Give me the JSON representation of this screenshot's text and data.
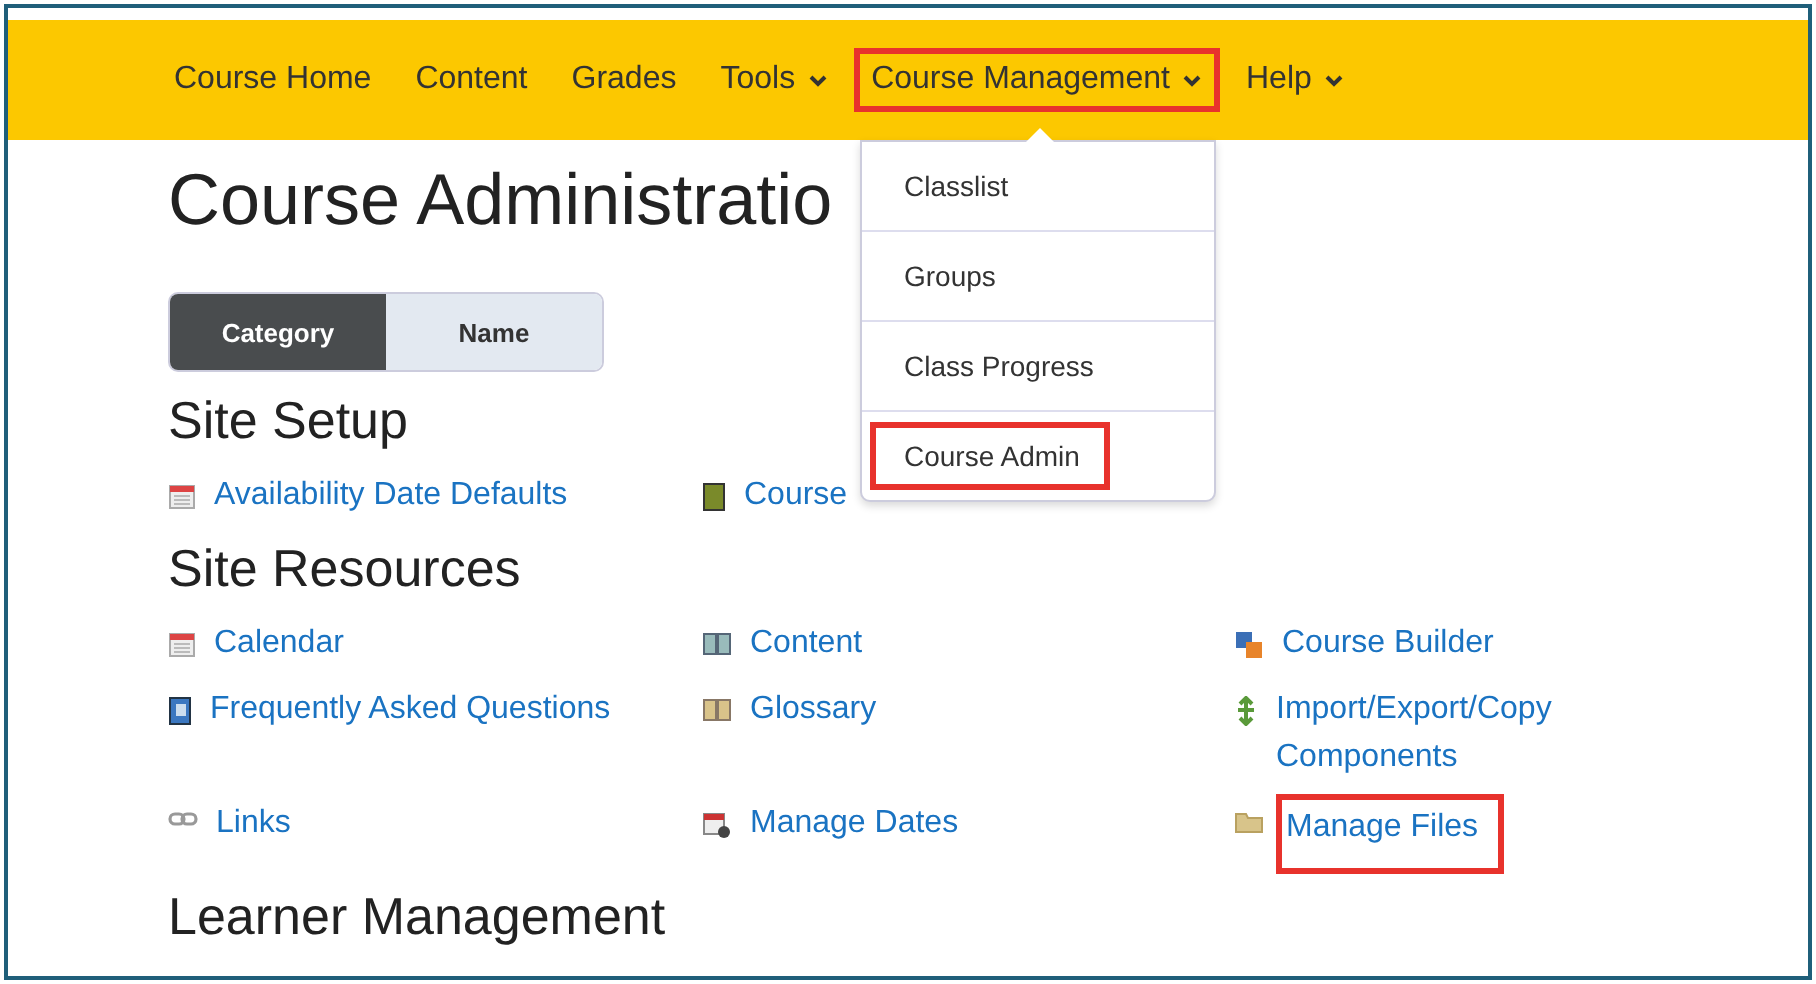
{
  "navbar": {
    "items": [
      {
        "label": "Course Home",
        "dropdown": false,
        "highlighted": false
      },
      {
        "label": "Content",
        "dropdown": false,
        "highlighted": false
      },
      {
        "label": "Grades",
        "dropdown": false,
        "highlighted": false
      },
      {
        "label": "Tools",
        "dropdown": true,
        "highlighted": false
      },
      {
        "label": "Course Management",
        "dropdown": true,
        "highlighted": true
      },
      {
        "label": "Help",
        "dropdown": true,
        "highlighted": false
      }
    ]
  },
  "menu": {
    "items": [
      {
        "label": "Classlist",
        "highlighted": false
      },
      {
        "label": "Groups",
        "highlighted": false
      },
      {
        "label": "Class Progress",
        "highlighted": false
      },
      {
        "label": "Course Admin",
        "highlighted": true
      }
    ]
  },
  "page_title": "Course Administratio",
  "view_toggle": [
    {
      "label": "Category",
      "selected": true
    },
    {
      "label": "Name",
      "selected": false
    }
  ],
  "sections": [
    {
      "heading": "Site Setup",
      "links": [
        {
          "label": "Availability Date Defaults",
          "highlighted": false
        },
        {
          "label": "Course",
          "highlighted": false
        }
      ]
    },
    {
      "heading": "Site Resources",
      "links": [
        {
          "label": "Calendar",
          "highlighted": false
        },
        {
          "label": "Content",
          "highlighted": false
        },
        {
          "label": "Course Builder",
          "highlighted": false
        },
        {
          "label": "Frequently Asked Questions",
          "highlighted": false
        },
        {
          "label": "Glossary",
          "highlighted": false
        },
        {
          "label": "Import/Export/Copy Components",
          "highlighted": false
        },
        {
          "label": "Links",
          "highlighted": false
        },
        {
          "label": "Manage Dates",
          "highlighted": false
        },
        {
          "label": "Manage Files",
          "highlighted": true
        }
      ]
    },
    {
      "heading": "Learner Management"
    }
  ]
}
